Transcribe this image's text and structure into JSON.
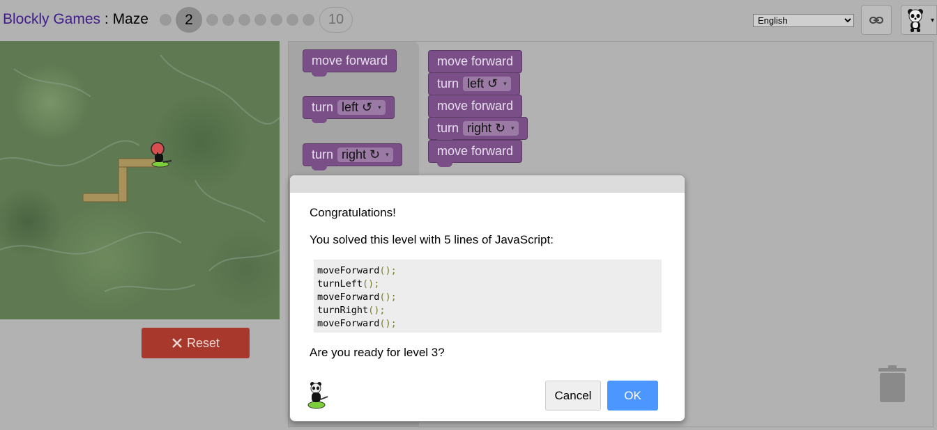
{
  "header": {
    "app_name": "Blockly Games",
    "separator": " : ",
    "game_name": "Maze",
    "levels": {
      "current_label": "2",
      "last_label": "10",
      "current": 2,
      "total": 10
    },
    "language": {
      "selected": "English",
      "options": [
        "English"
      ]
    },
    "link_icon": "link-icon",
    "avatar_icon": "panda-avatar-icon",
    "avatar_caret": "▾"
  },
  "game": {
    "reset_label": "Reset",
    "reset_icon": "close-x-icon",
    "colors": {
      "reset": "#a8382c",
      "path": "#a8925c",
      "marker": "#d64f4f"
    }
  },
  "toolbox": {
    "blocks": [
      {
        "label": "move forward"
      },
      {
        "label": "turn",
        "dropdown": "left ↺"
      },
      {
        "label": "turn",
        "dropdown": "right ↻"
      }
    ]
  },
  "program": {
    "blocks": [
      {
        "label": "move forward"
      },
      {
        "label": "turn",
        "dropdown": "left ↺"
      },
      {
        "label": "move forward"
      },
      {
        "label": "turn",
        "dropdown": "right ↻"
      },
      {
        "label": "move forward"
      }
    ],
    "block_color": "#7a4e86"
  },
  "dialog": {
    "congrats": "Congratulations!",
    "summary": "You solved this level with 5 lines of JavaScript:",
    "code_lines": [
      {
        "name": "moveForward",
        "paren": "();"
      },
      {
        "name": "turnLeft",
        "paren": "();"
      },
      {
        "name": "moveForward",
        "paren": "();"
      },
      {
        "name": "turnRight",
        "paren": "();"
      },
      {
        "name": "moveForward",
        "paren": "();"
      }
    ],
    "question": "Are you ready for level 3?",
    "cancel_label": "Cancel",
    "ok_label": "OK",
    "ok_color": "#4c97ff"
  },
  "icons": {
    "trash": "trash-can-icon",
    "dropdown_arrow": "▾"
  }
}
